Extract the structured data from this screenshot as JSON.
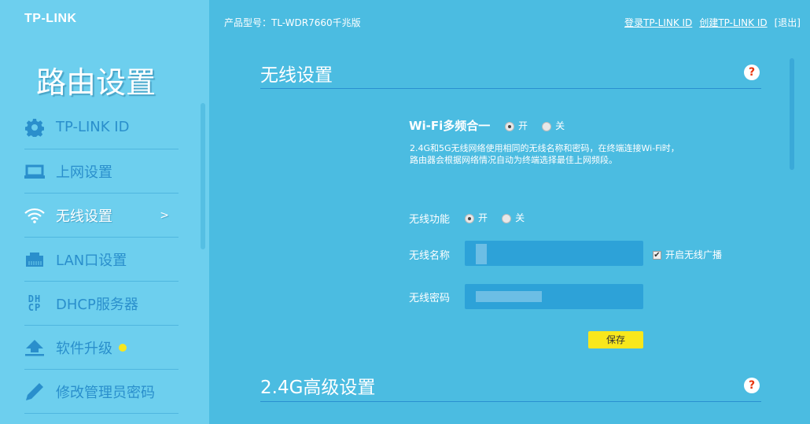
{
  "brand": "TP-LINK",
  "sidebar": {
    "title": "路由设置",
    "items": [
      {
        "label": "TP-LINK ID",
        "icon": "gear-icon"
      },
      {
        "label": "上网设置",
        "icon": "laptop-icon"
      },
      {
        "label": "无线设置",
        "icon": "wifi-icon",
        "active": true,
        "arrow": ">"
      },
      {
        "label": "LAN口设置",
        "icon": "ethernet-port-icon"
      },
      {
        "label": "DHCP服务器",
        "icon": "dhcp-icon",
        "icon_text": [
          "DH",
          "CP"
        ]
      },
      {
        "label": "软件升级",
        "icon": "upload-icon"
      },
      {
        "label": "修改管理员密码",
        "icon": "pencil-icon"
      }
    ]
  },
  "header": {
    "model": "产品型号：TL-WDR7660千兆版",
    "login": "登录TP-LINK ID",
    "create": "创建TP-LINK ID",
    "logout": "[退出]"
  },
  "wireless": {
    "title": "无线设置",
    "help": "?",
    "multiband_label": "Wi-Fi多频合一",
    "on": "开",
    "off": "关",
    "desc1": "2.4G和5G无线网络使用相同的无线名称和密码，在终端连接Wi-Fi时，",
    "desc2": "路由器会根据网络情况自动为终端选择最佳上网频段。",
    "func_label": "无线功能",
    "name_label": "无线名称",
    "pwd_label": "无线密码",
    "broadcast_label": "开启无线广播",
    "save": "保存"
  },
  "advanced": {
    "title": "2.4G高级设置",
    "help": "?"
  },
  "colors": {
    "sidebar": "#6dcfee",
    "main": "#4bbce1",
    "accent": "#2a8fcc",
    "save": "#f8e71c"
  }
}
